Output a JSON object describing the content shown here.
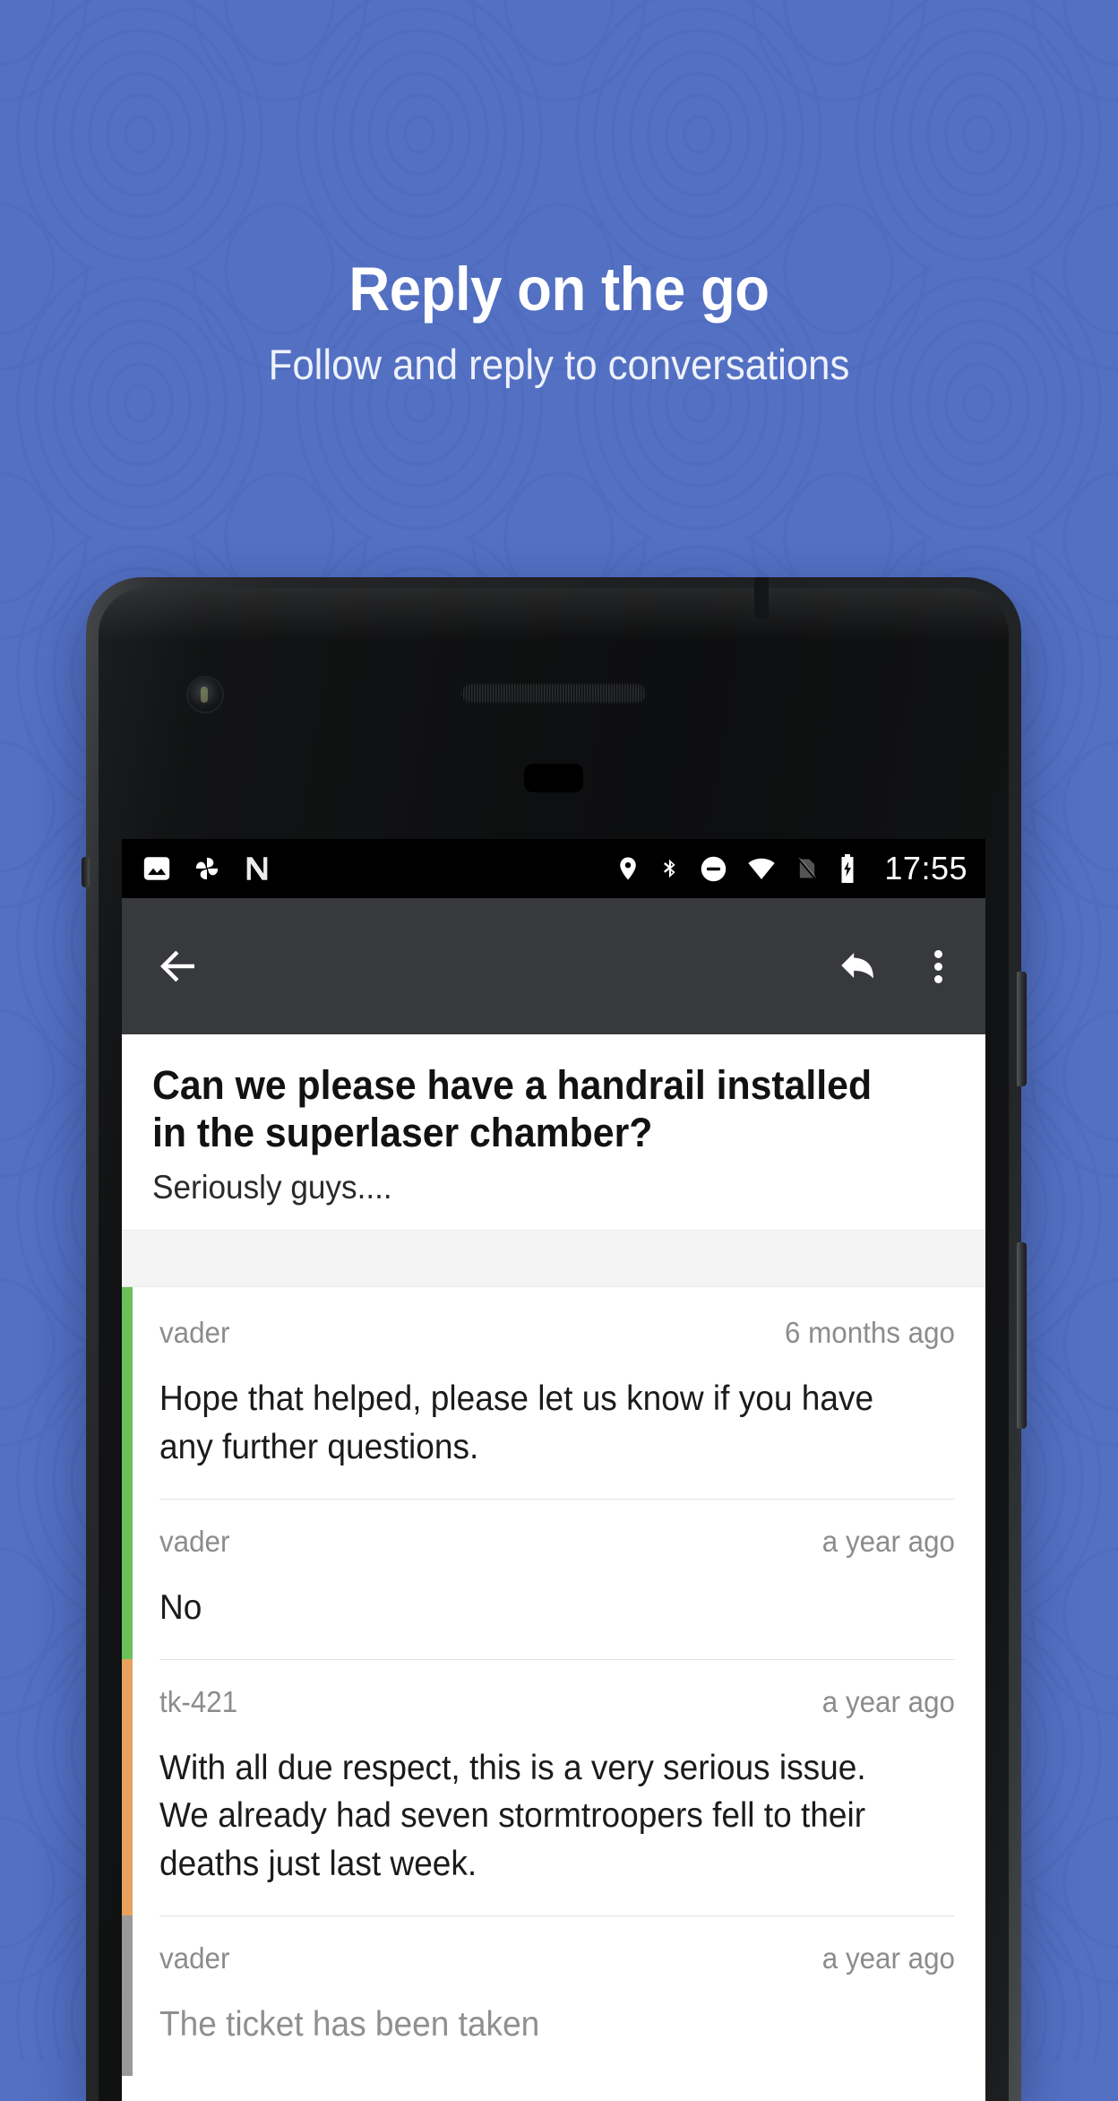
{
  "promo": {
    "headline": "Reply on the go",
    "subheadline": "Follow and reply to conversations",
    "background_color": "#5370c3",
    "headline_color": "#ffffff",
    "subheadline_color": "#eef1fb"
  },
  "phone": {
    "frame_color": "#1d1f21",
    "hardware": {
      "front_camera": "front-camera",
      "earpiece": "earpiece-speaker",
      "sensor": "proximity-sensor",
      "antenna": "antenna-line",
      "power_button": "power-button",
      "volume_button": "volume-button"
    }
  },
  "statusbar": {
    "background_color": "#000000",
    "clock": "17:55",
    "left_icons": [
      "image-icon",
      "pinwheel-icon",
      "n-logo-icon"
    ],
    "right_icons": [
      "location-pin-icon",
      "bluetooth-icon",
      "do-not-disturb-icon",
      "wifi-icon",
      "no-sim-icon",
      "battery-charging-icon"
    ]
  },
  "appbar": {
    "background_color": "#37393d",
    "back_label": "Back",
    "reply_label": "Reply",
    "overflow_label": "More options"
  },
  "ticket": {
    "title": "Can we please have a handrail installed in the superlaser chamber?",
    "subtitle": "Seriously guys...."
  },
  "comments": [
    {
      "author": "vader",
      "time": "6 months ago",
      "text": "Hope that helped, please let us know if you have any further questions.",
      "accent_color": "#6cc05a",
      "muted": false
    },
    {
      "author": "vader",
      "time": "a year ago",
      "text": "No",
      "accent_color": "#6cc05a",
      "muted": false
    },
    {
      "author": "tk-421",
      "time": "a year ago",
      "text": "With all due respect, this is a very serious issue. We already had seven stormtroopers fell to their deaths just last week.",
      "accent_color": "#e8a15e",
      "muted": false
    },
    {
      "author": "vader",
      "time": "a year ago",
      "text": "The ticket has been taken",
      "accent_color": "#9a9a9a",
      "muted": true
    }
  ]
}
